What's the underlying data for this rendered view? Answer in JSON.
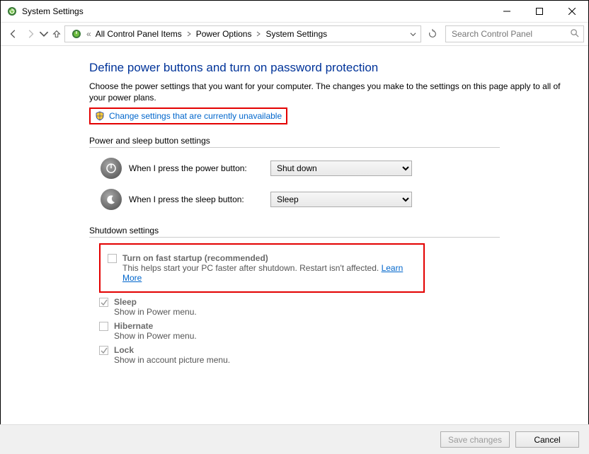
{
  "window": {
    "title": "System Settings"
  },
  "breadcrumb": {
    "items": [
      {
        "label": "All Control Panel Items"
      },
      {
        "label": "Power Options"
      },
      {
        "label": "System Settings"
      }
    ]
  },
  "search": {
    "placeholder": "Search Control Panel"
  },
  "page": {
    "title": "Define power buttons and turn on password protection",
    "description": "Choose the power settings that you want for your computer. The changes you make to the settings on this page apply to all of your power plans.",
    "change_link": "Change settings that are currently unavailable"
  },
  "power_section": {
    "header": "Power and sleep button settings",
    "rows": [
      {
        "label": "When I press the power button:",
        "value": "Shut down"
      },
      {
        "label": "When I press the sleep button:",
        "value": "Sleep"
      }
    ]
  },
  "shutdown_section": {
    "header": "Shutdown settings",
    "items": [
      {
        "title": "Turn on fast startup (recommended)",
        "sub": "This helps start your PC faster after shutdown. Restart isn't affected.",
        "learn": "Learn More"
      },
      {
        "title": "Sleep",
        "sub": "Show in Power menu."
      },
      {
        "title": "Hibernate",
        "sub": "Show in Power menu."
      },
      {
        "title": "Lock",
        "sub": "Show in account picture menu."
      }
    ]
  },
  "footer": {
    "save": "Save changes",
    "cancel": "Cancel"
  }
}
